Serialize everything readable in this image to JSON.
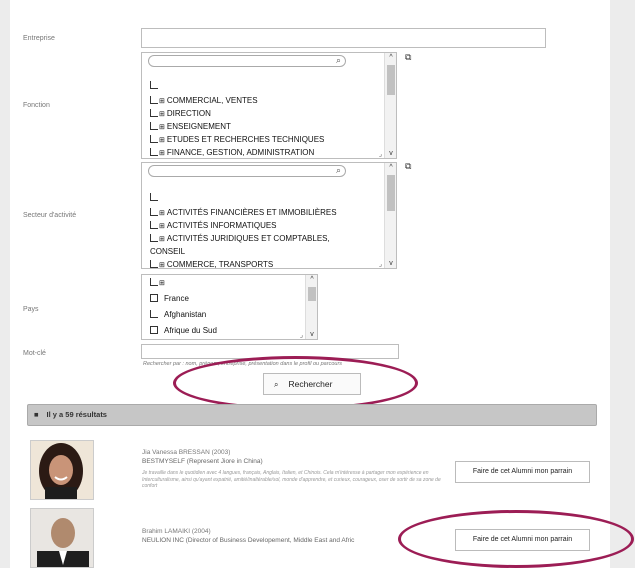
{
  "form": {
    "entreprise_label": "Entreprise",
    "fonction_label": "Fonction",
    "secteur_label": "Secteur d'activité",
    "pays_label": "Pays",
    "motcle_label": "Mot-clé",
    "hint": "Rechercher par : nom, prénom, entreprise, présentation dans le profil ou parcours",
    "search_button": "Rechercher",
    "fonction_options": [
      "COMMERCIAL, VENTES",
      "DIRECTION",
      "ENSEIGNEMENT",
      "ETUDES ET RECHERCHES TECHNIQUES",
      "FINANCE, GESTION, ADMINISTRATION"
    ],
    "secteur_options": [
      "ACTIVITÉS FINANCIÈRES ET IMMOBILIÈRES",
      "ACTIVITÉS INFORMATIQUES",
      "ACTIVITÉS JURIDIQUES ET COMPTABLES,",
      "CONSEIL",
      "COMMERCE, TRANSPORTS"
    ],
    "pays_options": [
      "France",
      "Afghanistan",
      "Afrique du Sud"
    ]
  },
  "results": {
    "count_text": "Il y a 59 résultats",
    "items": [
      {
        "name": "Jia Vanessa BRESSAN (2003)",
        "job": "BESTMYSELF (Represent Jiore in China)",
        "desc": "Je travaille dans le quotidien avec 4 langues, français, Anglais, Italien, et Chinois. Cela m'intéresse à partager mon expérience en Interculturalisme, ainsi qu'ayant expatrié, amitié/inaltérable/sol, monde d'apprendre, et curieux, courageux, oser de sortir de sa zone de confort",
        "button": "Faire de cet Alumni mon parrain"
      },
      {
        "name": "Brahim LAMAIKI (2004)",
        "job": "NEULION INC (Director of Business Developement, Middle East and Afric",
        "desc": "",
        "button": "Faire de cet Alumni mon parrain"
      }
    ]
  },
  "colors": {
    "highlight_ellipse": "#9c1d55",
    "results_bar": "#c6c6c6"
  }
}
